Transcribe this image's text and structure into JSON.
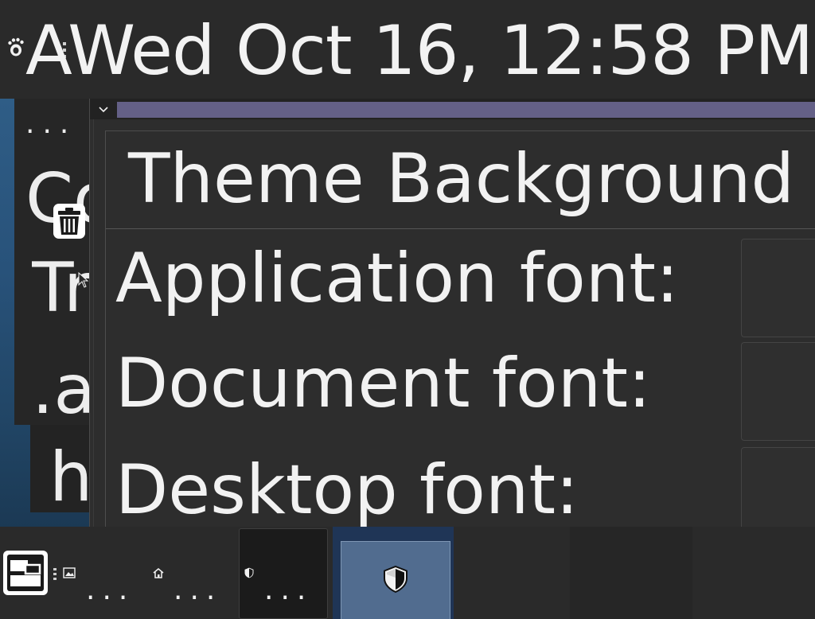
{
  "top_panel": {
    "menu_icon": "gnome-foot-icon",
    "clock_text": "AWed Oct 16, 12:58 PM"
  },
  "desktop": {
    "dots": "...",
    "text_fragments": [
      "Co",
      "Tr",
      ".as",
      "h"
    ],
    "trash_icon": "trash-icon",
    "cursor_icon": "mouse-pointer-icon"
  },
  "window": {
    "menu_icon": "chevron-down-icon",
    "tabs": [
      {
        "label": "Theme"
      },
      {
        "label": "Background"
      }
    ],
    "font_rows": [
      {
        "label": "Application font:"
      },
      {
        "label": "Document font:"
      },
      {
        "label": "Desktop font:"
      }
    ]
  },
  "taskbar": {
    "show_desktop_icon": "show-desktop-icon",
    "launchers": [
      {
        "icon": "image-viewer-icon",
        "dots": "..."
      },
      {
        "icon": "home-folder-icon",
        "dots": "..."
      },
      {
        "icon": "shield-icon",
        "dots": "..."
      }
    ],
    "active_task_icon": "shield-icon"
  },
  "colors": {
    "panel_bg": "#2a2a2a",
    "window_bg": "#2d2d2d",
    "titlebar_accent": "#646087",
    "active_task": "#516c8f",
    "desktop_blue": "#2f5d86",
    "text": "#f2f2f2"
  }
}
